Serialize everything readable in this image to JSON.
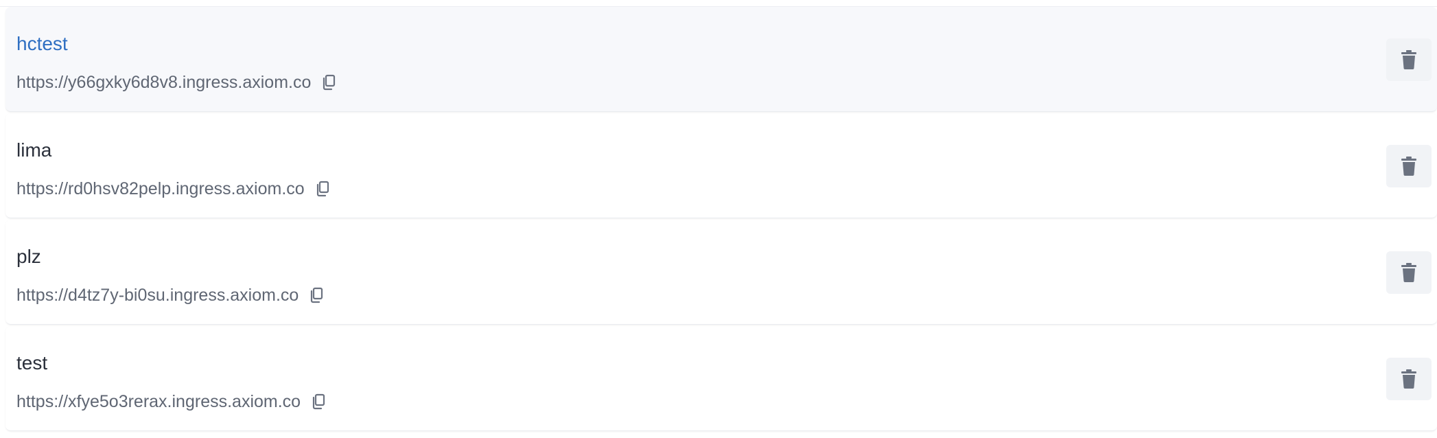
{
  "endpoints": [
    {
      "name": "hctest",
      "url": "https://y66gxky6d8v8.ingress.axiom.co",
      "selected": true
    },
    {
      "name": "lima",
      "url": "https://rd0hsv82pelp.ingress.axiom.co",
      "selected": false
    },
    {
      "name": "plz",
      "url": "https://d4tz7y-bi0su.ingress.axiom.co",
      "selected": false
    },
    {
      "name": "test",
      "url": "https://xfye5o3rerax.ingress.axiom.co",
      "selected": false
    }
  ],
  "icons": {
    "copy": "copy-icon",
    "delete": "trash-icon"
  },
  "colors": {
    "selected_name": "#2f6fc2",
    "name": "#2b303b",
    "url": "#5f6673",
    "selected_row_bg": "#f7f8fb",
    "delete_button_bg": "#f1f3f6",
    "icon": "#6b7280"
  }
}
